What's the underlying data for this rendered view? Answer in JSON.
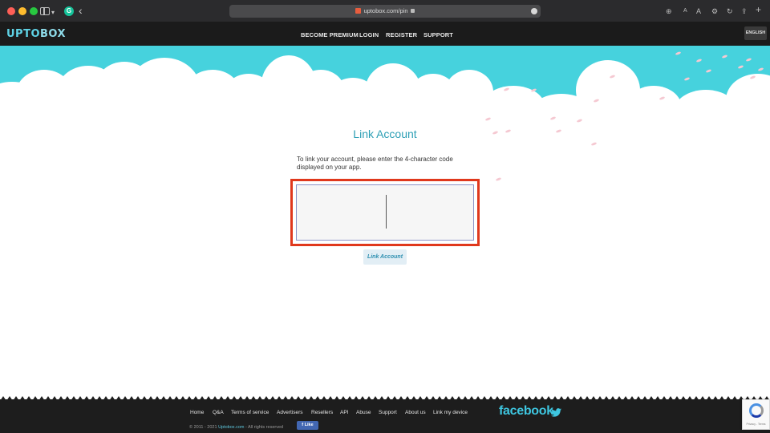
{
  "browser": {
    "url": "uptobox.com/pin"
  },
  "site": {
    "logo_text_a": "UPTO",
    "logo_text_b": "BOX",
    "nav": [
      "BECOME PREMIUM",
      "LOGIN",
      "REGISTER",
      "SUPPORT"
    ],
    "language": "ENGLISH"
  },
  "main": {
    "title": "Link Account",
    "instructions": "To link your account, please enter the 4-character code displayed on your app.",
    "code_value": "",
    "submit_label": "Link Account"
  },
  "footer": {
    "links": [
      "Home",
      "Q&A",
      "Terms of service",
      "Advertisers",
      "Resellers",
      "API",
      "Abuse",
      "Support",
      "About us",
      "Link my device"
    ],
    "copyright_prefix": "© 2011 - 2021",
    "copyright_brand": "Uptobox.com",
    "copyright_suffix": "- All rights reserved",
    "like_label": "Like",
    "facebook_label": "facebook",
    "recaptcha_text": "Privacy - Terms"
  },
  "colors": {
    "accent": "#2d9fb5",
    "highlight": "#e0381c",
    "sky": "#46d2dd"
  }
}
